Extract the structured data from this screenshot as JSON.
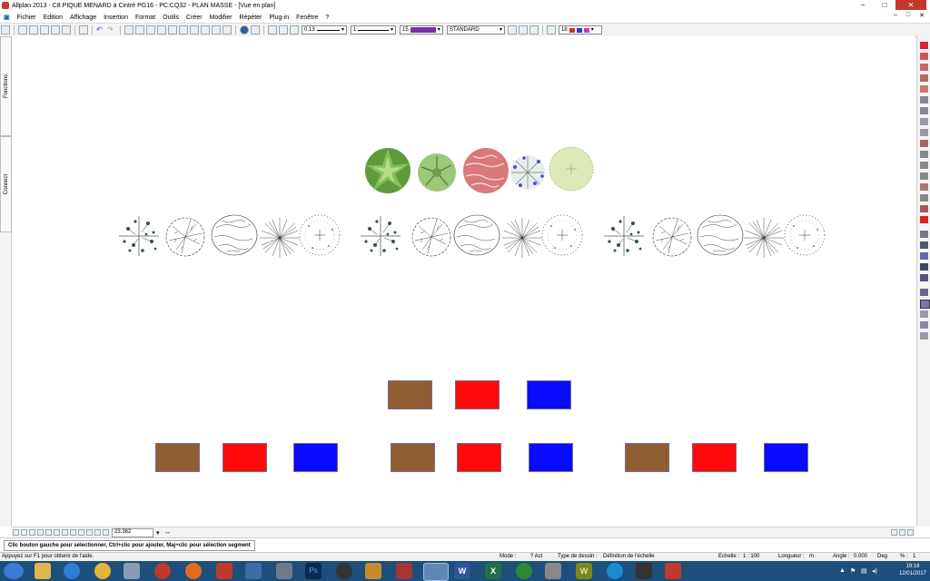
{
  "window": {
    "title": "Allplan 2013 - C8 PIQUE MENARD à Cintré PG16 - PC:CQ32 - PLAN MASSE - [Vue en plan]",
    "controls": {
      "minimize": "–",
      "maximize": "□",
      "close": "✕"
    }
  },
  "menu": {
    "items": [
      "Fichier",
      "Edition",
      "Affichage",
      "Insertion",
      "Format",
      "Outils",
      "Créer",
      "Modifier",
      "Répéter",
      "Plug-in",
      "Fenêtre",
      "?"
    ],
    "doc_controls": [
      "–",
      "□",
      "✕"
    ]
  },
  "toolbar": {
    "pen_thickness": "0.13",
    "line_style": "1",
    "pen_color_index": "15",
    "pen_color": "#7b2fa8",
    "layer": "STANDARD",
    "font_size": "18"
  },
  "left_tabs": {
    "fonctions": "Fonctions",
    "connect": "Connect"
  },
  "drawing": {
    "color_symbols": [
      "green-bush",
      "light-green-shrub",
      "red-tree",
      "blue-flower-shrub",
      "pale-circle-tree"
    ],
    "line_symbols": [
      "sparse-tree",
      "round-tree",
      "oval-tree",
      "spiky-tree",
      "dotted-tree"
    ],
    "rect_colors": {
      "brown": "#8f5e34",
      "red": "#ff0a0a",
      "blue": "#0a0aff"
    }
  },
  "bottom_toolbar": {
    "zoom_value": "23.362"
  },
  "hint": "Clic bouton gauche pour sélectionner, Ctrl+clic pour ajouter, Maj+clic pour sélection segment",
  "status": {
    "help": "Appuyez sur F1 pour obtenir de l'aide.",
    "mode_label": "Mode :",
    "mode_value": "? Act",
    "drawing_type_label": "Type de dessin :",
    "drawing_type_value": "Définition de l'échelle",
    "scale_label": "Echelle :",
    "scale_value": "1 : 100",
    "length_label": "Longueur :",
    "length_value": "m",
    "angle_label": "Angle :",
    "angle_value": "0.000",
    "angle_unit": "Deg",
    "percent_label": "% :",
    "percent_value": "1"
  },
  "taskbar": {
    "time": "19:18",
    "date": "12/01/2017"
  }
}
